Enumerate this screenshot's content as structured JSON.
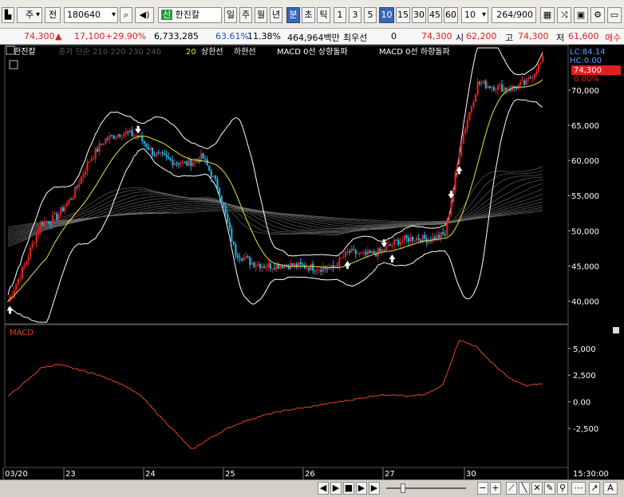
{
  "toolbar": {
    "market_label": "주",
    "prev_label": "전",
    "code": "180640",
    "stock_name": "한진칼",
    "stock_badge": "신",
    "period_day": "일",
    "period_week": "주",
    "period_month": "월",
    "period_year": "년",
    "period_min": "분",
    "period_sec": "초",
    "period_tick": "틱",
    "intervals": [
      "1",
      "3",
      "5",
      "10",
      "15",
      "30",
      "45",
      "60"
    ],
    "selected_interval": "10",
    "interval_select": "10",
    "count_value": "264",
    "count_total": "/900"
  },
  "quote": {
    "price": "74,300",
    "change": "17,100",
    "change_pct": "+29.90%",
    "volume": "6,733,285",
    "turnover_pct": "63.61%",
    "ratio_pct": "11.38%",
    "trade_amount": "464,964백만",
    "best_label": "최우선",
    "best_value": "0",
    "current": "74,300",
    "open_label": "시",
    "open_value": "62,200",
    "high_label": "고",
    "high_value": "74,300",
    "low_label": "저",
    "low_value": "61,600",
    "extra_label": "매수"
  },
  "legend": {
    "name": "한진칼",
    "ma_text": "종가 단순 210  220  230  240",
    "ma20": "20",
    "upper_limit": "상한선",
    "lower_limit": "하한선",
    "macd_up": "MACD 0선 상향돌파",
    "macd_down": "MACD 0선 하향돌파"
  },
  "price_panel": {
    "lc_label": "LC:84.14",
    "hc_label": "HC:0.00",
    "last_price": "74,300",
    "last_pct": "0.00%",
    "y_ticks": [
      "70,000",
      "65,000",
      "60,000",
      "55,000",
      "50,000",
      "45,000",
      "40,000"
    ]
  },
  "macd_panel": {
    "title": "MACD",
    "y_ticks": [
      "5,000",
      "2,500",
      "0.00",
      "-2,500"
    ]
  },
  "x_axis": {
    "labels": [
      "03/20",
      "23",
      "24",
      "25",
      "26",
      "27",
      "30"
    ],
    "time_label": "15:30:00"
  },
  "chart_data": {
    "type": "candlestick+macd",
    "x": [
      "03/20",
      "23",
      "24",
      "25",
      "26",
      "27",
      "30"
    ],
    "ylim": [
      37000,
      76000
    ],
    "close_path": [
      40000,
      45000,
      51000,
      52000,
      55000,
      60000,
      63000,
      64000,
      63500,
      61000,
      60000,
      59500,
      60500,
      56000,
      47000,
      45500,
      45000,
      45200,
      45000,
      44800,
      44600,
      47000,
      46500,
      47000,
      48500,
      49000,
      48800,
      49500,
      63000,
      71000,
      70500,
      70200,
      71000,
      74300
    ],
    "macd": [
      500,
      1800,
      3200,
      3500,
      3100,
      2700,
      2200,
      1500,
      500,
      -1200,
      -2800,
      -4500,
      -3500,
      -2600,
      -1900,
      -1400,
      -1000,
      -700,
      -500,
      -200,
      50,
      300,
      600,
      700,
      500,
      700,
      1500,
      5800,
      5200,
      3600,
      2200,
      1500,
      1700
    ]
  },
  "colors": {
    "up": "#e02020",
    "down": "#14b6e8",
    "ma20": "#e6e63a",
    "band": "#ffffff",
    "macd": "#e0481a",
    "background": "#000000"
  }
}
